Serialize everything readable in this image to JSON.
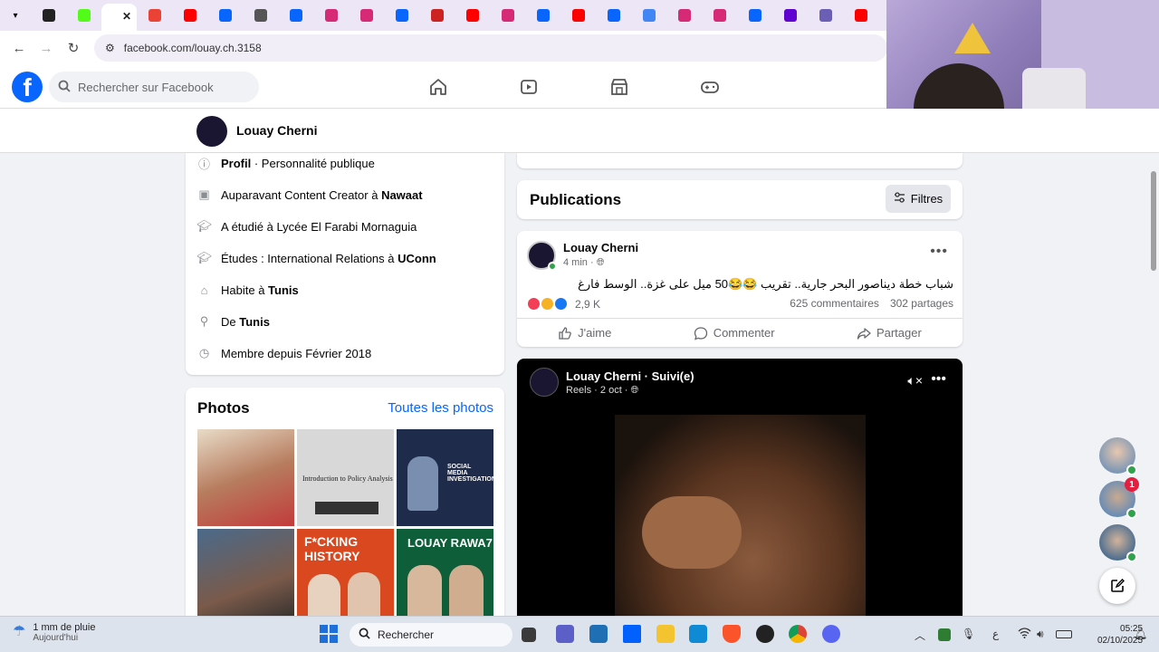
{
  "browser": {
    "url": "facebook.com/louay.ch.3158",
    "tab_menu_icon": "chevron-down-icon",
    "tabs": [
      {
        "icon": "app-icon",
        "color": "#222222"
      },
      {
        "icon": "kick-icon",
        "color": "#53fc18"
      },
      {
        "icon": "active-tab",
        "color": "#ffffff"
      },
      {
        "icon": "gmail-icon",
        "color": "#ea4335"
      },
      {
        "icon": "youtube-icon",
        "color": "#ff0000"
      },
      {
        "icon": "facebook-icon",
        "color": "#0866ff"
      },
      {
        "icon": "audio-icon",
        "color": "#555555"
      },
      {
        "icon": "facebook-icon",
        "color": "#0866ff"
      },
      {
        "icon": "instagram-icon",
        "color": "#d62976"
      },
      {
        "icon": "instagram-icon",
        "color": "#d62976"
      },
      {
        "icon": "facebook-icon",
        "color": "#0866ff"
      },
      {
        "icon": "plane-icon",
        "color": "#cc2222"
      },
      {
        "icon": "youtube-icon",
        "color": "#ff0000"
      },
      {
        "icon": "instagram-icon",
        "color": "#d62976"
      },
      {
        "icon": "facebook-icon",
        "color": "#0866ff"
      },
      {
        "icon": "youtube-icon",
        "color": "#ff0000"
      },
      {
        "icon": "facebook-icon",
        "color": "#0866ff"
      },
      {
        "icon": "google-icon",
        "color": "#4285f4"
      },
      {
        "icon": "instagram-icon",
        "color": "#d62976"
      },
      {
        "icon": "instagram-icon",
        "color": "#d62976"
      },
      {
        "icon": "facebook-icon",
        "color": "#0866ff"
      },
      {
        "icon": "yahoo-icon",
        "color": "#6001d2"
      },
      {
        "icon": "globe-icon",
        "color": "#6b5fb5"
      },
      {
        "icon": "youtube-icon",
        "color": "#ff0000"
      }
    ]
  },
  "facebook": {
    "search_placeholder": "Rechercher sur Facebook",
    "brand_color": "#0866ff",
    "logo_letter": "f"
  },
  "profile": {
    "name": "Louay Cherni"
  },
  "intro": {
    "rows": [
      {
        "icon": "info-icon",
        "pre": "",
        "bold": "Profil",
        "post": " · Personnalité publique"
      },
      {
        "icon": "briefcase-icon",
        "pre": "Auparavant Content Creator à ",
        "bold": "Nawaat",
        "post": ""
      },
      {
        "icon": "graduation-icon",
        "pre": "A étudié à Lycée El Farabi Mornaguia",
        "bold": "",
        "post": ""
      },
      {
        "icon": "graduation-icon",
        "pre": "Études : International Relations à ",
        "bold": "UConn",
        "post": ""
      },
      {
        "icon": "home-icon",
        "pre": "Habite à ",
        "bold": "Tunis",
        "post": ""
      },
      {
        "icon": "location-icon",
        "pre": "De ",
        "bold": "Tunis",
        "post": ""
      },
      {
        "icon": "clock-icon",
        "pre": "Membre depuis Février 2018",
        "bold": "",
        "post": ""
      }
    ]
  },
  "photos": {
    "title": "Photos",
    "all_link": "Toutes les photos",
    "thumbs": [
      {
        "caption": ""
      },
      {
        "caption": "Introduction to Policy Analysis"
      },
      {
        "caption": "SOCIAL MEDIA INVESTIGATION"
      },
      {
        "caption": ""
      },
      {
        "caption": "F*CKING HISTORY"
      },
      {
        "caption": "LOUAY RAWA7"
      }
    ]
  },
  "feed": {
    "publications_title": "Publications",
    "filters_label": "Filtres",
    "post": {
      "author": "Louay Cherni",
      "time": "4 min",
      "text": "شباب خطة ديناصور البحر جارية.. تقريب 😂😂50 ميل على غزة.. الوسط فارغ",
      "reactions_count": "2,9 K",
      "comments": "625 commentaires",
      "shares": "302 partages",
      "like_label": "J'aime",
      "comment_label": "Commenter",
      "share_label": "Partager"
    },
    "reel": {
      "author": "Louay Cherni · Suivi(e)",
      "meta": "Reels · 2 oct ·"
    }
  },
  "chat": {
    "badge_count": "1"
  },
  "taskbar": {
    "weather_line1": "1 mm de pluie",
    "weather_line2": "Aujourd'hui",
    "search_label": "Rechercher",
    "time": "05:25",
    "date": "02/10/2025",
    "lang": "ع"
  }
}
